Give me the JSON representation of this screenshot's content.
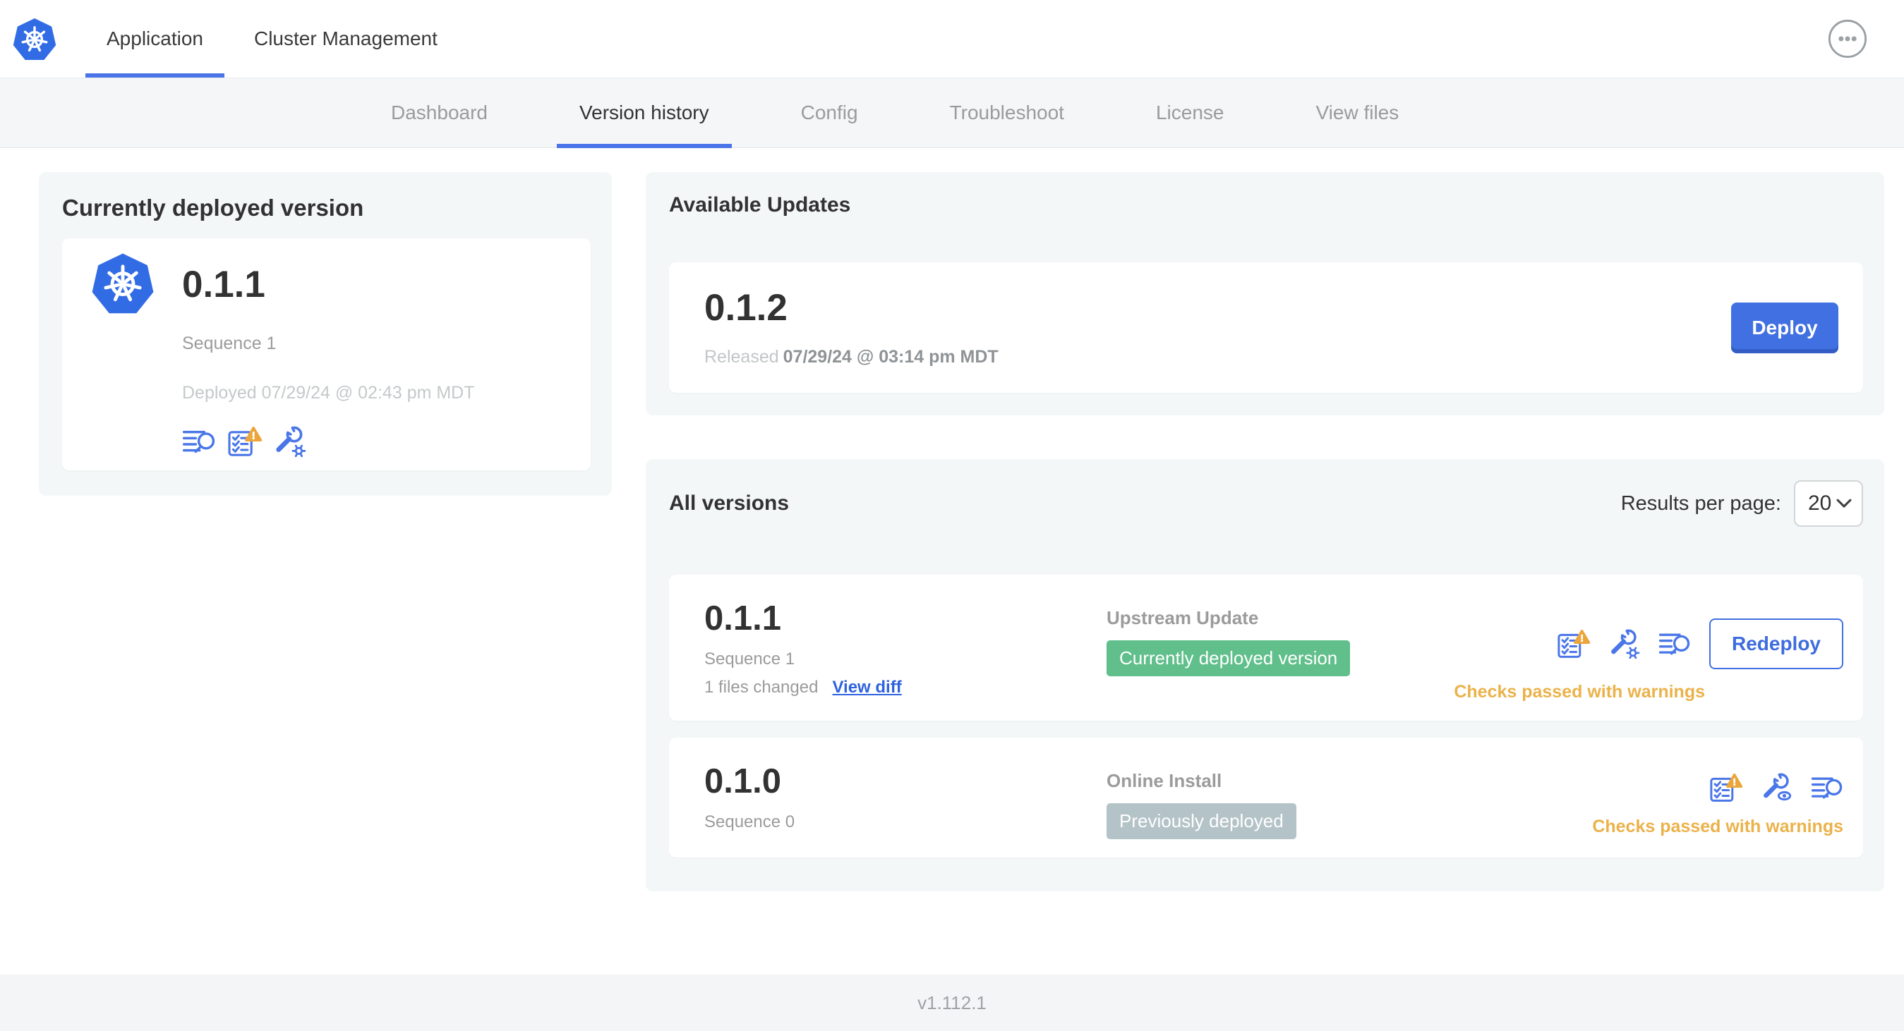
{
  "topnav": {
    "tabs": [
      {
        "label": "Application"
      },
      {
        "label": "Cluster Management"
      }
    ]
  },
  "subnav": {
    "tabs": [
      {
        "label": "Dashboard"
      },
      {
        "label": "Version history"
      },
      {
        "label": "Config"
      },
      {
        "label": "Troubleshoot"
      },
      {
        "label": "License"
      },
      {
        "label": "View files"
      }
    ]
  },
  "current_version": {
    "title": "Currently deployed version",
    "version": "0.1.1",
    "sequence": "Sequence 1",
    "deployed": "Deployed 07/29/24 @ 02:43 pm MDT",
    "icons": [
      "view-logs-icon",
      "preflight-checks-warning-icon",
      "edit-config-icon"
    ]
  },
  "available_updates": {
    "title": "Available Updates",
    "version": "0.1.2",
    "released_label": "Released",
    "released_date": "07/29/24 @ 03:14 pm MDT",
    "deploy_label": "Deploy"
  },
  "all_versions": {
    "title": "All versions",
    "results_per_page_label": "Results per page:",
    "results_per_page_value": "20",
    "rows": [
      {
        "version": "0.1.1",
        "sequence": "Sequence 1",
        "files_changed": "1 files changed",
        "view_diff_label": "View diff",
        "source": "Upstream Update",
        "badge": "Currently deployed version",
        "badge_color": "#60BF8B",
        "status": "Checks passed with warnings",
        "action_label": "Redeploy",
        "icons": [
          "preflight-checks-warning-icon",
          "edit-config-icon",
          "view-logs-icon"
        ]
      },
      {
        "version": "0.1.0",
        "sequence": "Sequence 0",
        "source": "Online Install",
        "badge": "Previously deployed",
        "badge_color": "#B4C3C8",
        "status": "Checks passed with warnings",
        "icons": [
          "preflight-checks-warning-icon",
          "view-config-icon",
          "view-logs-icon"
        ]
      }
    ]
  },
  "footer": {
    "console_version": "v1.112.1"
  },
  "colors": {
    "kubernetes_blue": "#326CE5",
    "accent_blue": "#4170E2",
    "link_blue": "#2F62DE",
    "icon_blue": "#4A76E8",
    "success_green": "#60BF8B",
    "neutral_gray_badge": "#B4C3C8",
    "warning_orange": "#EBB24A",
    "text_dark": "#323232",
    "text_gray": "#9B9B9B",
    "text_light_gray": "#C5C9CB"
  }
}
